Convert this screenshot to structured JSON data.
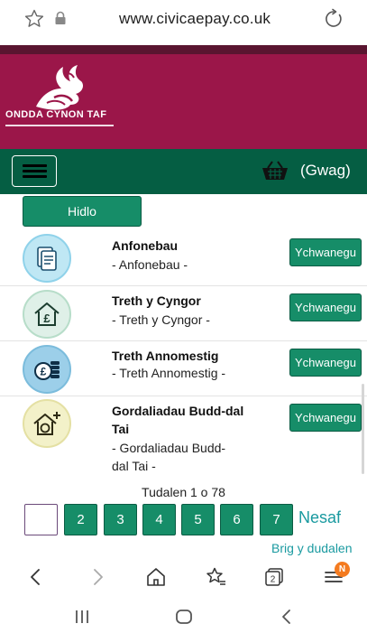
{
  "browser": {
    "url": "www.civicaepay.co.uk",
    "icons": [
      "star-outline-icon",
      "lock-icon",
      "reload-icon"
    ]
  },
  "site": {
    "brand": "ONDDA CYNON TAF",
    "logo_icon": "dragon-logo-icon",
    "colors": {
      "banner": "#9b1649",
      "nav": "#055e43",
      "button": "#168d68",
      "link": "#1a9aa0"
    }
  },
  "nav": {
    "menu_icon": "hamburger-icon",
    "basket_icon": "basket-icon",
    "cart_label": "(Gwag)"
  },
  "filter_label": "Hidlo",
  "items": [
    {
      "icon": "document-icon",
      "title_lines": [
        "Anfonebau"
      ],
      "subtitle_lines": [
        "- Anfonebau -"
      ],
      "add_label": "Ychwanegu"
    },
    {
      "icon": "house-pound-icon",
      "title_lines": [
        "Treth y Cyngor"
      ],
      "subtitle_lines": [
        "- Treth y Cyngor -"
      ],
      "add_label": "Ychwanegu"
    },
    {
      "icon": "coins-icon",
      "title_lines": [
        "Treth Annomestig"
      ],
      "subtitle_lines": [
        "- Treth Annomestig -"
      ],
      "add_label": "Ychwanegu"
    },
    {
      "icon": "house-plus-coins-icon",
      "title_lines": [
        "Gordaliadau Budd-dal",
        "Tai"
      ],
      "subtitle_lines": [
        "- Gordaliadau Budd-",
        "dal Tai -"
      ],
      "add_label": "Ychwanegu"
    }
  ],
  "pagination": {
    "info": "Tudalen 1 o 78",
    "pages": [
      "",
      "2",
      "3",
      "4",
      "5",
      "6",
      "7"
    ],
    "next_label": "Nesaf",
    "back_to_top": "Brig y dudalen"
  },
  "browser_toolbar": {
    "icons": [
      "back-arrow-icon",
      "forward-arrow-icon",
      "home-icon",
      "bookmarks-icon",
      "tabs-icon",
      "menu-icon"
    ],
    "tabs_count": "2",
    "badge": "N"
  },
  "system_nav": {
    "icons": [
      "recent-apps-icon",
      "home-button-icon",
      "back-button-icon"
    ]
  }
}
